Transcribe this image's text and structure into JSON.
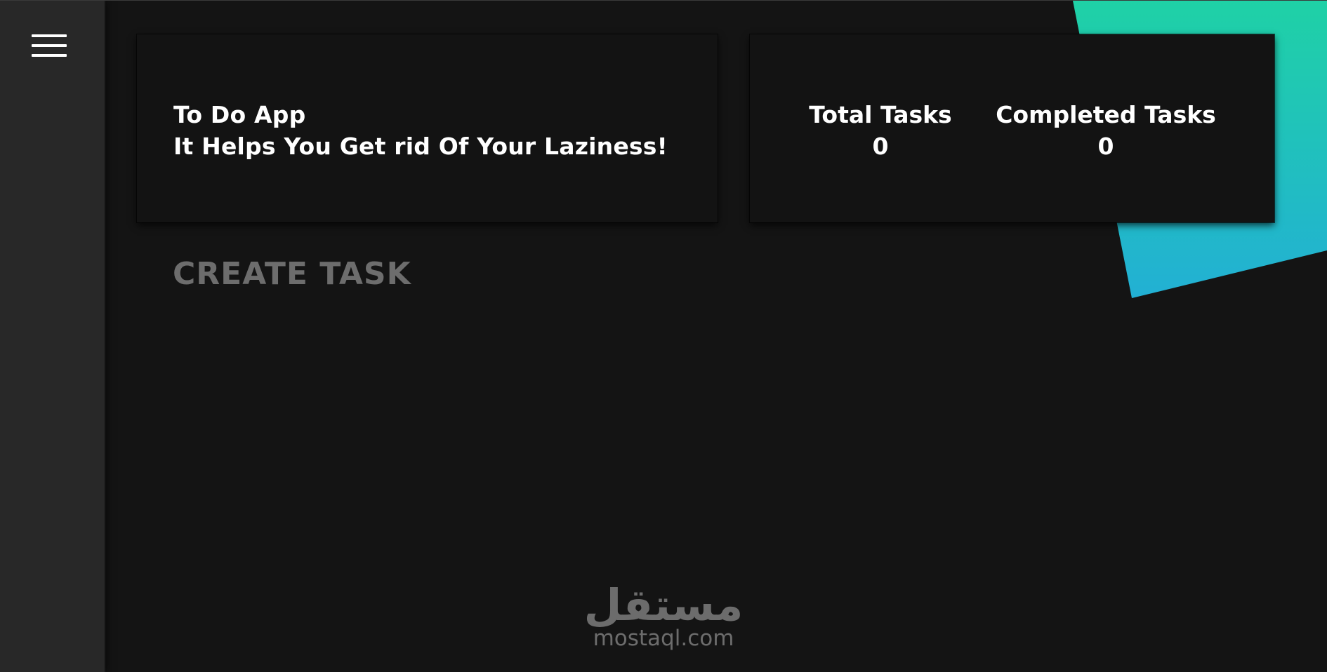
{
  "sidebar": {
    "menu_icon": "hamburger-menu-icon"
  },
  "header": {
    "app_title": "To Do App",
    "tagline": "It Helps You Get rid Of Your Laziness!"
  },
  "stats": {
    "total_label": "Total Tasks",
    "total_value": "0",
    "completed_label": "Completed Tasks",
    "completed_value": "0"
  },
  "main": {
    "create_task_label": "CREATE TASK"
  },
  "watermark": {
    "logo_text": "مستقل",
    "url": "mostaql.com"
  },
  "colors": {
    "background": "#141414",
    "sidebar": "#282828",
    "card": "#131313",
    "accent_top": "#1fd1a6",
    "accent_bottom": "#22b4d0",
    "muted_text": "#6d6d6d"
  }
}
